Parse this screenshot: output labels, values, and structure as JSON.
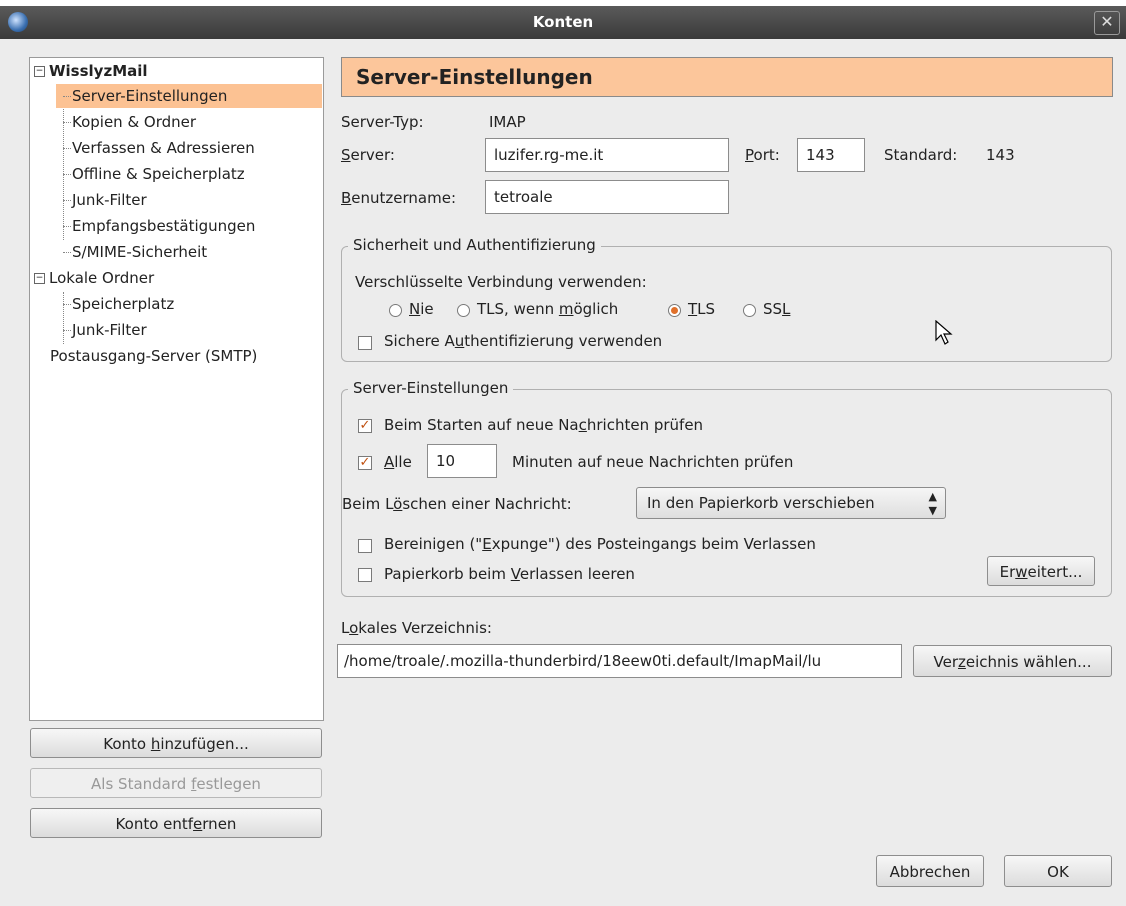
{
  "window": {
    "title": "Konten",
    "close_label": "✕"
  },
  "tree": {
    "account1": "WisslyzMail",
    "account1_items": [
      "Server-Einstellungen",
      "Kopien & Ordner",
      "Verfassen & Adressieren",
      "Offline & Speicherplatz",
      "Junk-Filter",
      "Empfangsbestätigungen",
      "S/MIME-Sicherheit"
    ],
    "account2": "Lokale Ordner",
    "account2_items": [
      "Speicherplatz",
      "Junk-Filter"
    ],
    "smtp": "Postausgang-Server (SMTP)",
    "selected_index": 0
  },
  "left_buttons": {
    "add_pre": "Konto ",
    "add_key": "h",
    "add_post": "inzufügen...",
    "default_pre": "Als Standard ",
    "default_key": "f",
    "default_post": "estlegen",
    "remove_pre": "Konto entf",
    "remove_key": "e",
    "remove_post": "rnen"
  },
  "header": {
    "title": "Server-Einstellungen"
  },
  "server": {
    "type_label": "Server-Typ:",
    "type_value": "IMAP",
    "server_key": "S",
    "server_rest": "erver:",
    "server_value": "luzifer.rg-me.it",
    "port_key": "P",
    "port_rest": "ort:",
    "port_value": "143",
    "standard_label": "Standard:",
    "standard_value": "143",
    "user_key": "B",
    "user_rest": "enutzername:",
    "user_value": "tetroale"
  },
  "security": {
    "legend": "Sicherheit und Authentifizierung",
    "encryption_label": "Verschlüsselte Verbindung verwenden:",
    "options": [
      {
        "pre": "",
        "key": "N",
        "post": "ie",
        "selected": false
      },
      {
        "pre": "TLS, wenn ",
        "key": "m",
        "post": "öglich",
        "selected": false
      },
      {
        "pre": "",
        "key": "T",
        "post": "LS",
        "selected": true
      },
      {
        "pre": "SS",
        "key": "L",
        "post": "",
        "selected": false
      }
    ],
    "secure_auth_pre": "Sichere A",
    "secure_auth_key": "u",
    "secure_auth_post": "thentifizierung verwenden",
    "secure_auth_checked": false
  },
  "server_settings": {
    "legend": "Server-Einstellungen",
    "check_start_pre": "Beim Starten auf neue Na",
    "check_start_key": "c",
    "check_start_post": "hrichten prüfen",
    "check_start_checked": true,
    "check_every_key": "A",
    "check_every_rest": "lle",
    "check_every_checked": true,
    "interval_value": "10",
    "interval_suffix": "Minuten auf neue Nachrichten prüfen",
    "delete_pre": "Beim L",
    "delete_key": "ö",
    "delete_post": "schen einer Nachricht:",
    "delete_option": "In den Papierkorb verschieben",
    "expunge_pre": "Bereinigen (\"",
    "expunge_key": "E",
    "expunge_post": "xpunge\") des Posteingangs beim Verlassen",
    "expunge_checked": false,
    "empty_trash_pre": "Papierkorb beim ",
    "empty_trash_key": "V",
    "empty_trash_post": "erlassen leeren",
    "empty_trash_checked": false,
    "advanced_pre": "Er",
    "advanced_key": "w",
    "advanced_post": "eitert..."
  },
  "local": {
    "label_pre": "L",
    "label_key": "o",
    "label_post": "kales Verzeichnis:",
    "path": "/home/troale/.mozilla-thunderbird/18eew0ti.default/ImapMail/lu",
    "choose_pre": "Ver",
    "choose_key": "z",
    "choose_post": "eichnis wählen..."
  },
  "footer": {
    "cancel": "Abbrechen",
    "ok": "OK"
  },
  "colors": {
    "accent": "#fcc69b",
    "selected": "#fcc293",
    "radio_on": "#e0702a"
  }
}
